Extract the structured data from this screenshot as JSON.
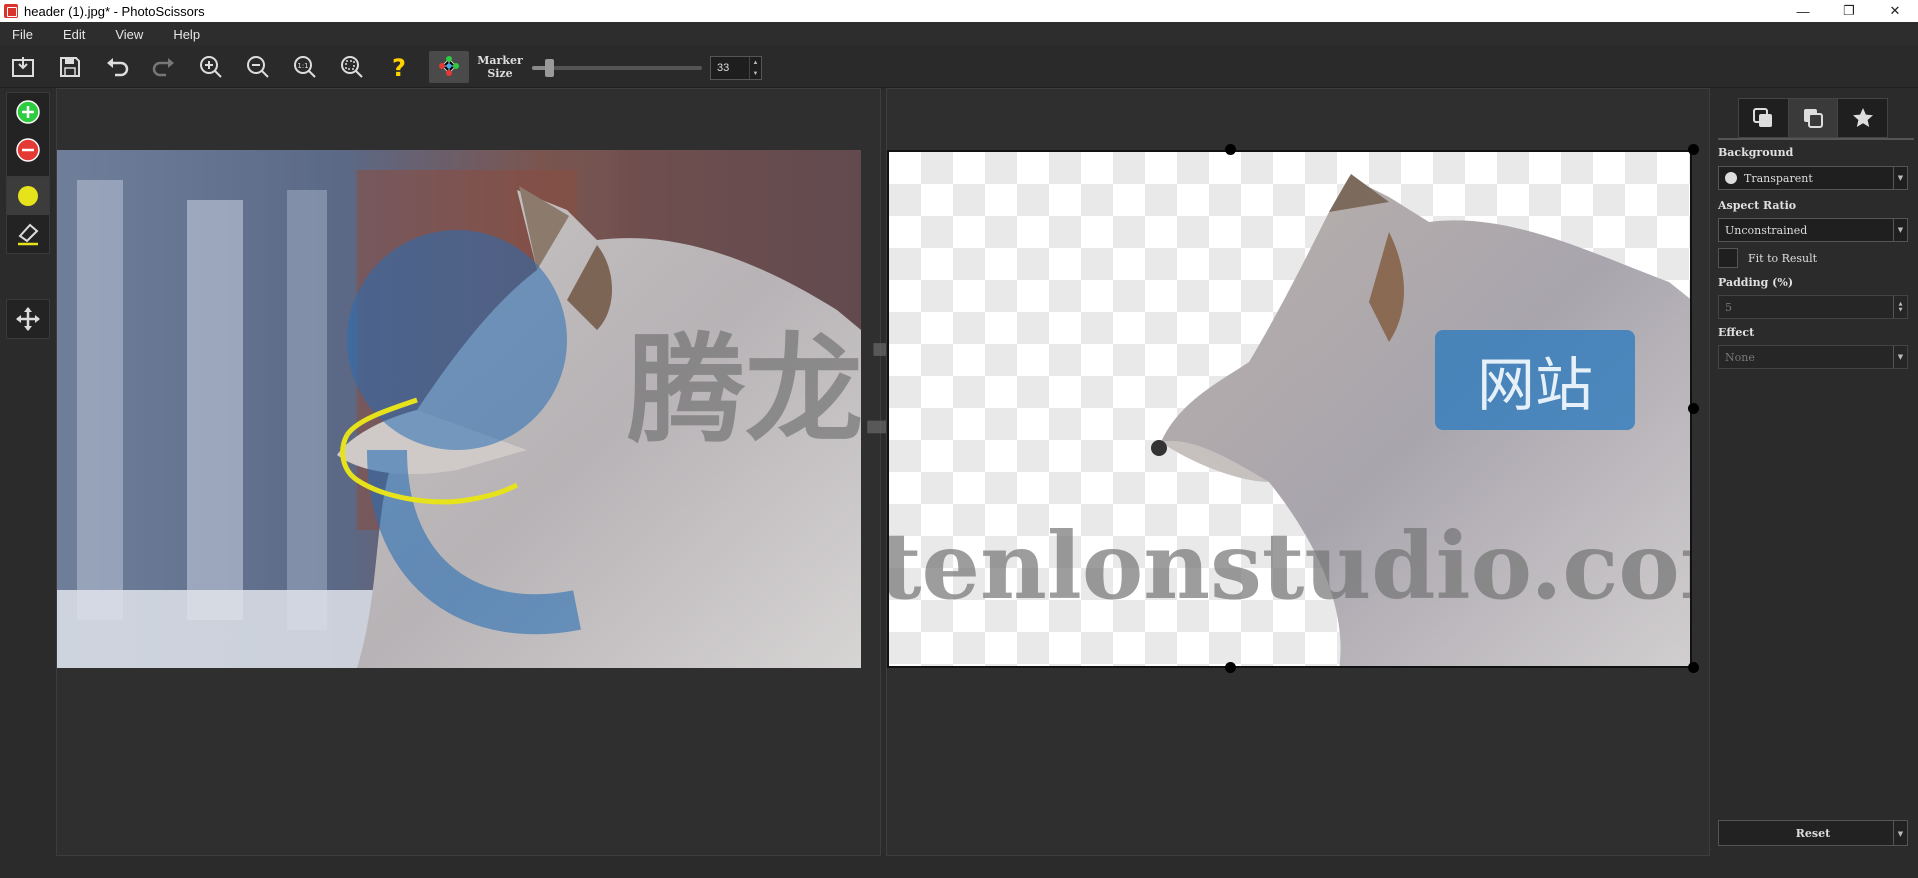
{
  "window": {
    "title": "header (1).jpg* - PhotoScissors",
    "minimize": "—",
    "maximize": "❐",
    "close": "✕"
  },
  "menu": [
    "File",
    "Edit",
    "View",
    "Help"
  ],
  "toolbar": {
    "marker_label_1": "Marker",
    "marker_label_2": "Size",
    "marker_size": "33",
    "marker_size_fraction": 0.1,
    "spin_up": "▲",
    "spin_down": "▼"
  },
  "watermark": {
    "main": "腾龙工作室",
    "badge": "网站",
    "domain": "tenlonstudio.com"
  },
  "panel": {
    "background_label": "Background",
    "background_value": "Transparent",
    "aspect_label": "Aspect Ratio",
    "aspect_value": "Unconstrained",
    "fit_label": "Fit to Result",
    "padding_label": "Padding (%)",
    "padding_value": "5",
    "effect_label": "Effect",
    "effect_value": "None",
    "reset_label": "Reset",
    "dropdown_arrow": "▼"
  },
  "colors": {
    "accent_green": "#2ecc40",
    "accent_red": "#e53935",
    "marker_yellow": "#e6e21c",
    "help_yellow": "#ffd200"
  }
}
